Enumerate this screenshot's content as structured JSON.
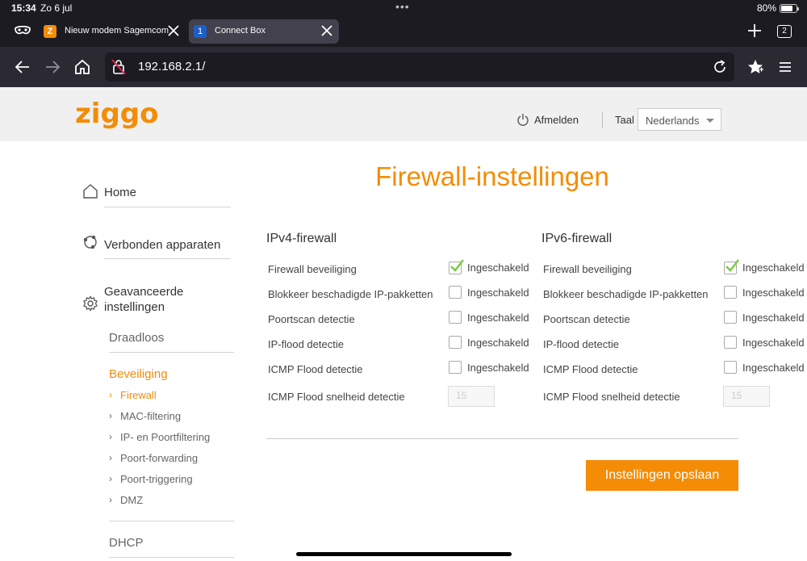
{
  "status": {
    "time": "15:34",
    "date": "Zo 6 jul",
    "battery": "80%",
    "battery_level": 0.8
  },
  "tabs": [
    {
      "favicon": "Z",
      "title": "Nieuw modem Sagemcom"
    },
    {
      "favicon": "1",
      "title": "Connect Box"
    }
  ],
  "tab_count": "2",
  "url": "192.168.2.1/",
  "header": {
    "logo_text": "ziggo",
    "logout": "Afmelden",
    "lang_label": "Taal",
    "lang_value": "Nederlands"
  },
  "sidebar": {
    "home": "Home",
    "connected": "Verbonden apparaten",
    "advanced": "Geavanceerde instellingen",
    "wireless": "Draadloos",
    "security": "Beveiliging",
    "security_items": [
      "Firewall",
      "MAC-filtering",
      "IP- en Poortfiltering",
      "Poort-forwarding",
      "Poort-triggering",
      "DMZ"
    ],
    "dhcp": "DHCP"
  },
  "main": {
    "title": "Firewall-instellingen",
    "ipv4": {
      "heading": "IPv4-firewall",
      "rows": [
        {
          "label": "Firewall beveiliging",
          "checked": true,
          "cb_label": "Ingeschakeld"
        },
        {
          "label": "Blokkeer beschadigde IP-pakketten",
          "checked": false,
          "cb_label": "Ingeschakeld"
        },
        {
          "label": "Poortscan detectie",
          "checked": false,
          "cb_label": "Ingeschakeld"
        },
        {
          "label": "IP-flood detectie",
          "checked": false,
          "cb_label": "Ingeschakeld"
        },
        {
          "label": "ICMP Flood detectie",
          "checked": false,
          "cb_label": "Ingeschakeld"
        }
      ],
      "rate_label": "ICMP Flood snelheid detectie",
      "rate_value": "15"
    },
    "ipv6": {
      "heading": "IPv6-firewall",
      "rows": [
        {
          "label": "Firewall beveiliging",
          "checked": true,
          "cb_label": "Ingeschakeld"
        },
        {
          "label": "Blokkeer beschadigde IP-pakketten",
          "checked": false,
          "cb_label": "Ingeschakeld"
        },
        {
          "label": "Poortscan detectie",
          "checked": false,
          "cb_label": "Ingeschakeld"
        },
        {
          "label": "IP-flood detectie",
          "checked": false,
          "cb_label": "Ingeschakeld"
        },
        {
          "label": "ICMP Flood detectie",
          "checked": false,
          "cb_label": "Ingeschakeld"
        }
      ],
      "rate_label": "ICMP Flood snelheid detectie",
      "rate_value": "15"
    },
    "save": "Instellingen opslaan"
  },
  "colors": {
    "accent": "#f48c06",
    "check": "#7ac943",
    "chrome_dark": "#1c1b22"
  }
}
